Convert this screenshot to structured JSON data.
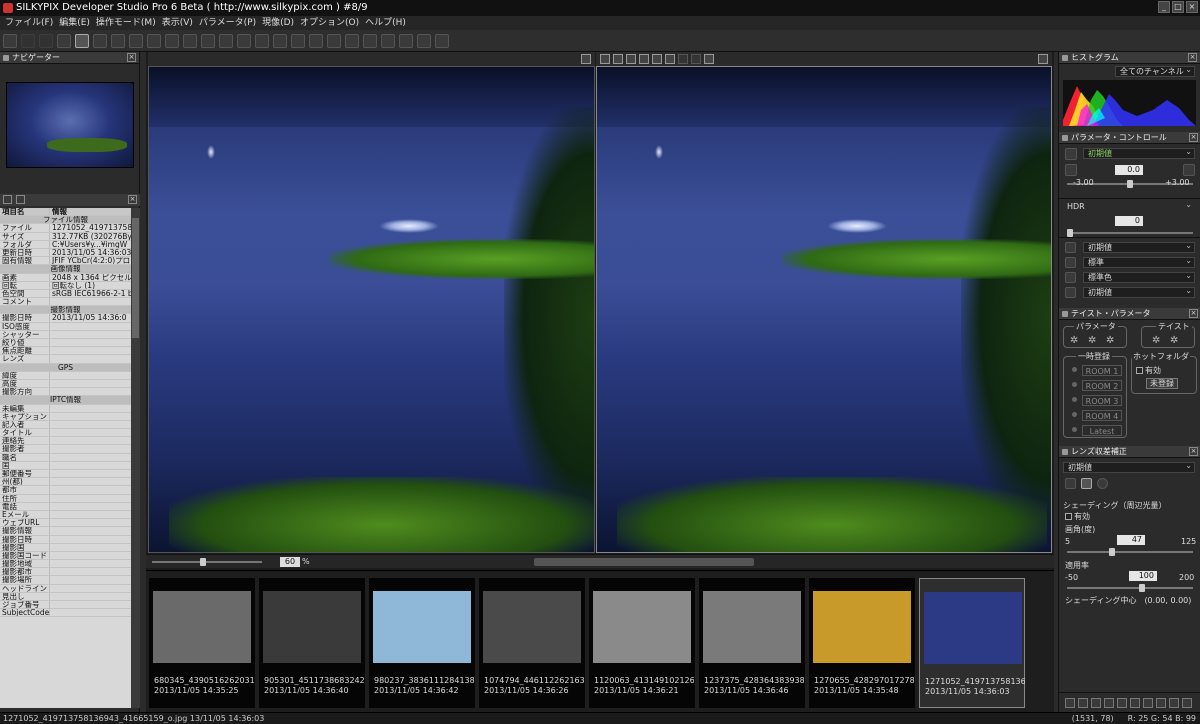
{
  "window": {
    "title": "SILKYPIX Developer Studio Pro 6 Beta ( http://www.silkypix.com )  #8/9"
  },
  "menu": [
    "ファイル(F)",
    "編集(E)",
    "操作モード(M)",
    "表示(V)",
    "パラメータ(P)",
    "現像(D)",
    "オプション(O)",
    "ヘルプ(H)"
  ],
  "navigator": {
    "title": "ナビゲーター"
  },
  "info": {
    "col_key": "項目名",
    "col_val": "情報",
    "rows": [
      {
        "sec": "ファイル情報"
      },
      {
        "k": "ファイル",
        "v": "1271052_4197137581"
      },
      {
        "k": "サイズ",
        "v": "312.77KB (320276Byt"
      },
      {
        "k": "フォルダ",
        "v": "C:¥Users¥y...¥imgW"
      },
      {
        "k": "更新日時",
        "v": "2013/11/05 14:36:03"
      },
      {
        "k": "固有情報",
        "v": "JFIF YCbCr(4:2:0)プロ"
      },
      {
        "sec": "画像情報"
      },
      {
        "k": "画素",
        "v": "2048 x 1364 ピクセル"
      },
      {
        "k": "回転",
        "v": "回転なし (1)"
      },
      {
        "k": "色空間",
        "v": "sRGB IEC61966-2-1 b"
      },
      {
        "k": "コメント",
        "v": ""
      },
      {
        "sec": "撮影情報"
      },
      {
        "k": "撮影日時",
        "v": "2013/11/05 14:36:0"
      },
      {
        "k": "ISO感度",
        "v": ""
      },
      {
        "k": "シャッター",
        "v": ""
      },
      {
        "k": "絞り値",
        "v": ""
      },
      {
        "k": "焦点距離",
        "v": ""
      },
      {
        "k": "レンズ",
        "v": ""
      },
      {
        "sec": "GPS"
      },
      {
        "k": "緯度",
        "v": ""
      },
      {
        "k": "高度",
        "v": ""
      },
      {
        "k": "撮影方向",
        "v": ""
      },
      {
        "sec": "IPTC情報"
      },
      {
        "k": "未編集",
        "v": ""
      },
      {
        "k": "キャプション",
        "v": ""
      },
      {
        "k": "記入者",
        "v": ""
      },
      {
        "k": "タイトル",
        "v": ""
      },
      {
        "k": "連絡先",
        "v": ""
      },
      {
        "k": "撮影者",
        "v": ""
      },
      {
        "k": "職名",
        "v": ""
      },
      {
        "k": "国",
        "v": ""
      },
      {
        "k": "郵便番号",
        "v": ""
      },
      {
        "k": "州(都)",
        "v": ""
      },
      {
        "k": "都市",
        "v": ""
      },
      {
        "k": "住所",
        "v": ""
      },
      {
        "k": "電話",
        "v": ""
      },
      {
        "k": "Eメール",
        "v": ""
      },
      {
        "k": "ウェブURL",
        "v": ""
      },
      {
        "k": "撮影情報",
        "v": ""
      },
      {
        "k": "撮影日時",
        "v": ""
      },
      {
        "k": "撮影国",
        "v": ""
      },
      {
        "k": "撮影国コード",
        "v": ""
      },
      {
        "k": "撮影地域",
        "v": ""
      },
      {
        "k": "撮影都市",
        "v": ""
      },
      {
        "k": "撮影場所",
        "v": ""
      },
      {
        "k": "ヘッドライン",
        "v": ""
      },
      {
        "k": "見出し",
        "v": ""
      },
      {
        "k": "ジョブ番号",
        "v": ""
      },
      {
        "k": "SubjectCode",
        "v": ""
      }
    ]
  },
  "view": {
    "zoom": "60",
    "zoom_unit": "%"
  },
  "filmstrip": [
    {
      "name": "680345_4390516262031",
      "date": "2013/11/05 14:35:25",
      "tone": "#6a6a6a"
    },
    {
      "name": "905301_4511738683242",
      "date": "2013/11/05 14:36:40",
      "tone": "#3a3a3a"
    },
    {
      "name": "980237_3836111284138",
      "date": "2013/11/05 14:36:42",
      "tone": "#8fb7d8"
    },
    {
      "name": "1074794_446112262163",
      "date": "2013/11/05 14:36:26",
      "tone": "#4a4a4a"
    },
    {
      "name": "1120063_413149102126",
      "date": "2013/11/05 14:36:21",
      "tone": "#8a8a8a"
    },
    {
      "name": "1237375_428364383938",
      "date": "2013/11/05 14:36:46",
      "tone": "#7a7a7a"
    },
    {
      "name": "1270655_428297017278",
      "date": "2013/11/05 14:35:48",
      "tone": "#c89a2a"
    },
    {
      "name": "1271052_419713758136",
      "date": "2013/11/05 14:36:03",
      "tone": "#2c3a86"
    }
  ],
  "histogram": {
    "title": "ヒストグラム",
    "channel": "全てのチャンネル"
  },
  "param": {
    "title": "パラメータ・コントロール",
    "preset": "初期値",
    "exposure": "0.0",
    "exposure_min": "-3.00",
    "exposure_max": "+3.00",
    "exposure_level": 0.5,
    "hdr_label": "HDR",
    "hdr": "0",
    "hdr_level": 0,
    "rows": [
      "初期値",
      "標準",
      "標準色",
      "初期値"
    ]
  },
  "taste": {
    "title": "テイスト・パラメータ",
    "param_label": "パラメータ",
    "taste_label": "テイスト",
    "temp_label": "一時登録",
    "rooms": [
      "ROOM 1",
      "ROOM 2",
      "ROOM 3",
      "ROOM 4"
    ],
    "latest": "Latest",
    "hot_label": "ホットフォルダ",
    "enable": "有効",
    "unregistered": "未登録"
  },
  "lens": {
    "title": "レンズ収差補正",
    "preset": "初期値",
    "shading_label": "シェーディング（周辺光量）",
    "enable": "有効",
    "angle_label": "画角(度)",
    "angle_min": "5",
    "angle_max": "125",
    "angle": "47",
    "angle_level": 0.35,
    "rate_label": "適用率",
    "rate_min": "-50",
    "rate_max": "200",
    "rate": "100",
    "rate_level": 0.6,
    "center": "シェーディング中心　(0.00, 0.00)"
  },
  "status": {
    "file": "1271052_419713758136943_41665159_o.jpg 13/11/05 14:36:03",
    "coord": "(1531,   78)",
    "rgb": "R: 25 G: 54 B: 99"
  }
}
